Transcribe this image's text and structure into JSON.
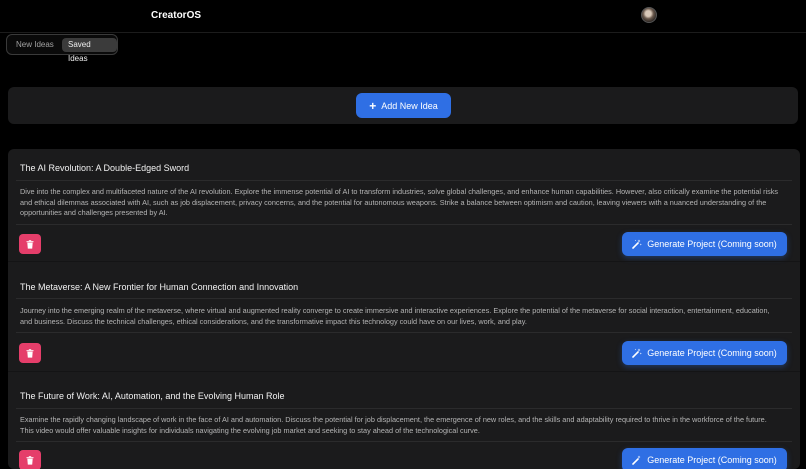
{
  "app": {
    "brand": "CreatorOS"
  },
  "tabs": [
    {
      "label": "New Ideas",
      "active": false
    },
    {
      "label": "Saved Ideas",
      "active": true
    }
  ],
  "add_button": {
    "label": "Add New Idea",
    "icon": "plus-icon"
  },
  "ideas": [
    {
      "title": "The AI Revolution: A Double-Edged Sword",
      "description": "Dive into the complex and multifaceted nature of the AI revolution. Explore the immense potential of AI to transform industries, solve global challenges, and enhance human capabilities. However, also critically examine the potential risks and ethical dilemmas associated with AI, such as job displacement, privacy concerns, and the potential for autonomous weapons. Strike a balance between optimism and caution, leaving viewers with a nuanced understanding of the opportunities and challenges presented by AI.",
      "generate_label": "Generate Project (Coming soon)"
    },
    {
      "title": "The Metaverse: A New Frontier for Human Connection and Innovation",
      "description": "Journey into the emerging realm of the metaverse, where virtual and augmented reality converge to create immersive and interactive experiences. Explore the potential of the metaverse for social interaction, entertainment, education, and business. Discuss the technical challenges, ethical considerations, and the transformative impact this technology could have on our lives, work, and play.",
      "generate_label": "Generate Project (Coming soon)"
    },
    {
      "title": "The Future of Work: AI, Automation, and the Evolving Human Role",
      "description": "Examine the rapidly changing landscape of work in the face of AI and automation. Discuss the potential for job displacement, the emergence of new roles, and the skills and adaptability required to thrive in the workforce of the future. This video would offer valuable insights for individuals navigating the evolving job market and seeking to stay ahead of the technological curve.",
      "generate_label": "Generate Project (Coming soon)"
    }
  ],
  "colors": {
    "accent": "#2f6fe4",
    "danger": "#e53e6a",
    "panel": "#1b1b1c",
    "background": "#000000"
  }
}
